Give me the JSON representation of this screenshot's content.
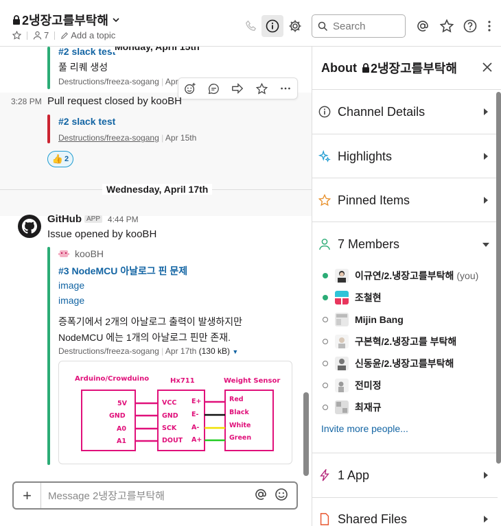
{
  "header": {
    "channel_name": "2냉장고를부탁해",
    "member_count": "7",
    "add_topic": "Add a topic",
    "search_placeholder": "Search"
  },
  "messages": {
    "date_1": "Monday, April 15th",
    "date_2": "Wednesday, April 17th",
    "prev_link": "#2 slack test",
    "prev_text": "풀 리퀘 생성",
    "prev_repo": "Destructions/freeza-sogang",
    "prev_date": "Apr",
    "msg1_time": "3:28 PM",
    "msg1_text": "Pull request closed by kooBH",
    "msg1_link": "#2 slack test",
    "msg1_repo": "Destructions/freeza-sogang",
    "msg1_date": "Apr 15th",
    "reaction_emoji": "👍",
    "reaction_count": "2",
    "gh_sender": "GitHub",
    "gh_app_badge": "APP",
    "gh_time": "4:44 PM",
    "gh_text": "Issue opened by kooBH",
    "gh_author": "kooBH",
    "gh_issue_title": "#3 NodeMCU 아날로그 핀 문제",
    "gh_image_1": "image",
    "gh_image_2": "image",
    "gh_body_1": "증폭기에서 2개의 아날로그 출력이 발생하지만",
    "gh_body_2": "NodeMCU 에는 1개의 아날로그 핀만 존재.",
    "gh_repo": "Destructions/freeza-sogang",
    "gh_date": "Apr 17th",
    "gh_size": "(130 kB)"
  },
  "diagram": {
    "left_title": "Arduino/Crowduino",
    "mid_title": "Hx711",
    "right_title": "Weight Sensor",
    "left_pins": [
      "5V",
      "GND",
      "A0",
      "A1"
    ],
    "mid_left_pins": [
      "VCC",
      "GND",
      "SCK",
      "DOUT"
    ],
    "mid_right_pins": [
      "E+",
      "E-",
      "A-",
      "A+"
    ],
    "right_pins": [
      "Red",
      "Black",
      "White",
      "Green"
    ]
  },
  "composer": {
    "placeholder": "Message 2냉장고를부탁해"
  },
  "panel": {
    "title": "About",
    "channel_name": "2냉장고를부탁해",
    "sections": {
      "details": "Channel Details",
      "highlights": "Highlights",
      "pinned": "Pinned Items",
      "members": "7 Members",
      "apps": "1 App",
      "files": "Shared Files"
    },
    "members": [
      {
        "name": "이규연/2.냉장고를부탁해",
        "suffix": "(you)"
      },
      {
        "name": "조철현"
      },
      {
        "name": "Mijin Bang"
      },
      {
        "name": "구본혁/2.냉장고를 부탁해"
      },
      {
        "name": "신동윤/2.냉장고를부탁해"
      },
      {
        "name": "전미정"
      },
      {
        "name": "최재규"
      }
    ],
    "invite": "Invite more people..."
  },
  "colors": {
    "link": "#1264a3",
    "online": "#2bac76",
    "gh_bar": "#2bac76",
    "pr_bar": "#cb2431",
    "diagram_pink": "#e0107a"
  }
}
